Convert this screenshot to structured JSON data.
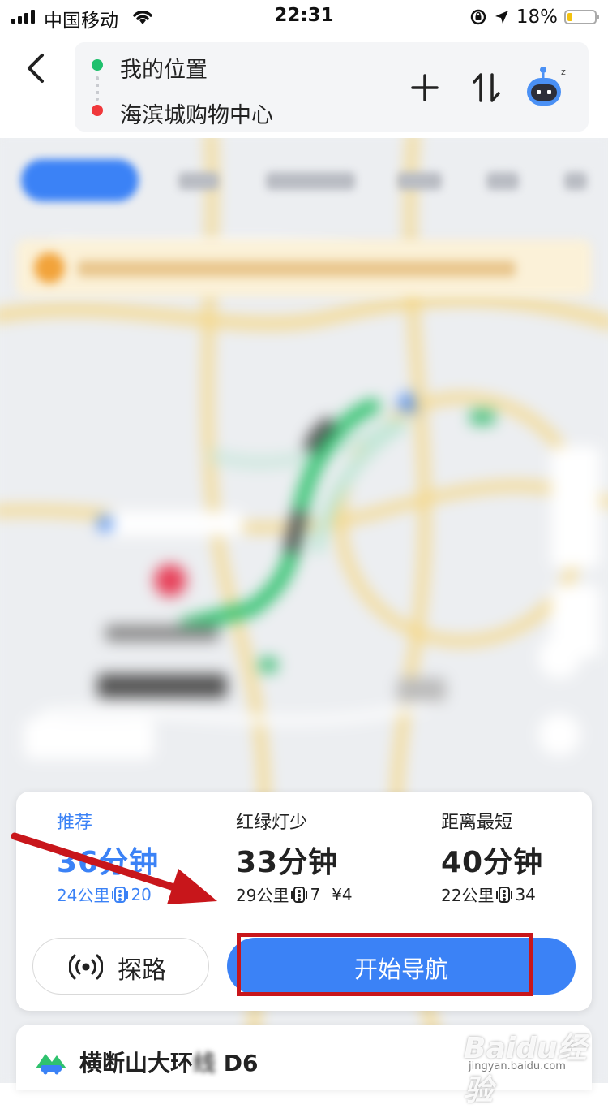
{
  "status_bar": {
    "carrier": "中国移动",
    "time": "22:31",
    "battery": "18%",
    "battery_level": 0.18
  },
  "header": {
    "from": "我的位置",
    "to": "海滨城购物中心"
  },
  "routes": [
    {
      "label": "推荐",
      "time": "36分钟",
      "distance": "24公里",
      "lights": "20",
      "toll": "",
      "selected": true
    },
    {
      "label": "红绿灯少",
      "time": "33分钟",
      "distance": "29公里",
      "lights": "7",
      "toll": "¥4",
      "selected": false
    },
    {
      "label": "距离最短",
      "time": "40分钟",
      "distance": "22公里",
      "lights": "34",
      "toll": "",
      "selected": false
    }
  ],
  "actions": {
    "probe": "探路",
    "navigate": "开始导航"
  },
  "bottom": {
    "route_name_start": "横断山大环",
    "route_name_blur": "线",
    "route_name_end": "D6"
  },
  "watermark": {
    "brand": "Baidu经验",
    "url": "jingyan.baidu.com"
  },
  "colors": {
    "accent": "#3b82f6",
    "highlight": "#c8161b",
    "route_green": "#2fc26e"
  }
}
